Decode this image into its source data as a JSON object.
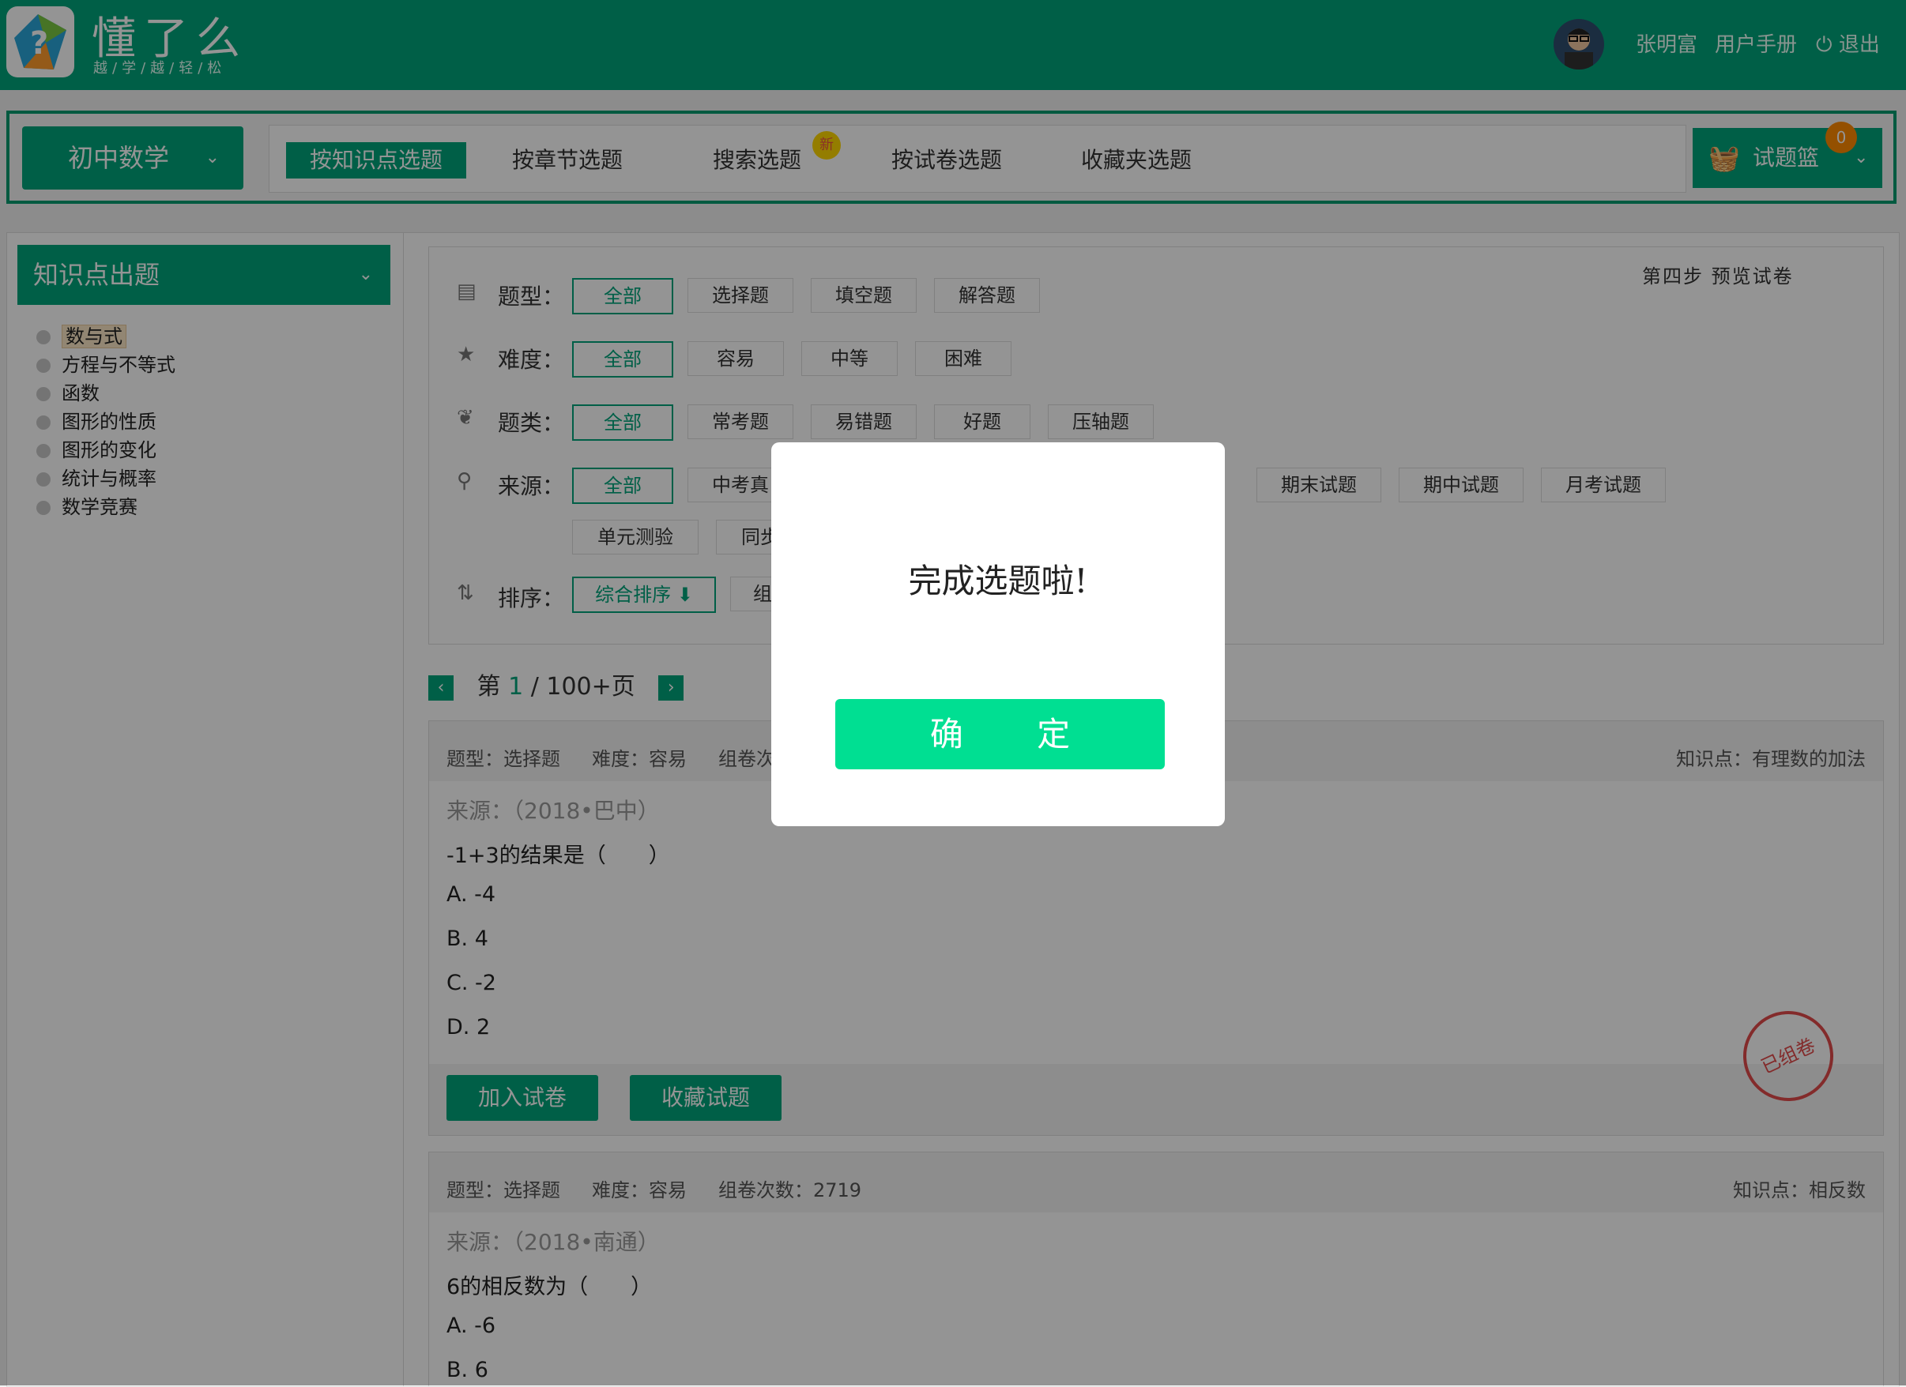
{
  "header": {
    "brand": "懂了么",
    "slogan": "越/学/越/轻/松",
    "username": "张明富",
    "manual": "用户手册",
    "logout": "退出",
    "accent": "#00a47a"
  },
  "nav": {
    "subject": "初中数学",
    "tabs": [
      "按知识点选题",
      "按章节选题",
      "搜索选题",
      "按试卷选题",
      "收藏夹选题"
    ],
    "new_badge": "新",
    "basket_label": "试题篮",
    "basket_count": "0"
  },
  "sidebar": {
    "title": "知识点出题",
    "items": [
      "数与式",
      "方程与不等式",
      "函数",
      "图形的性质",
      "图形的变化",
      "统计与概率",
      "数学竞赛"
    ]
  },
  "filters": {
    "step": "第四步  预览试卷",
    "type_label": "题型：",
    "type_options": [
      "全部",
      "选择题",
      "填空题",
      "解答题"
    ],
    "difficulty_label": "难度：",
    "difficulty_options": [
      "全部",
      "容易",
      "中等",
      "困难"
    ],
    "category_label": "题类：",
    "category_options": [
      "全部",
      "常考题",
      "易错题",
      "好题",
      "压轴题"
    ],
    "source_label": "来源：",
    "source_options": [
      "全部",
      "中考真",
      "期末试题",
      "期中试题",
      "月考试题",
      "单元测验",
      "同步"
    ],
    "sort_label": "排序：",
    "sort_options": [
      "综合排序 ⬇",
      "组"
    ]
  },
  "pager": {
    "prefix": "第",
    "current": "1",
    "suffix": "/ 100+页"
  },
  "questions": [
    {
      "meta_type": "题型：选择题",
      "meta_difficulty": "难度：容易",
      "meta_count": "组卷次",
      "knowledge": "知识点：有理数的加法",
      "source": "来源：（2018•巴中）",
      "text": "-1+3的结果是（　　）",
      "options": [
        "A. -4",
        "B. 4",
        "C. -2",
        "D. 2"
      ],
      "add_btn": "加入试卷",
      "fav_btn": "收藏试题",
      "stamp": "已组卷"
    },
    {
      "meta_type": "题型：选择题",
      "meta_difficulty": "难度：容易",
      "meta_count": "组卷次数：2719",
      "knowledge": "知识点：相反数",
      "source": "来源：（2018•南通）",
      "text": "6的相反数为（　　）",
      "options": [
        "A. -6",
        "B. 6"
      ]
    }
  ],
  "modal": {
    "message": "完成选题啦!",
    "confirm": "确 定"
  }
}
